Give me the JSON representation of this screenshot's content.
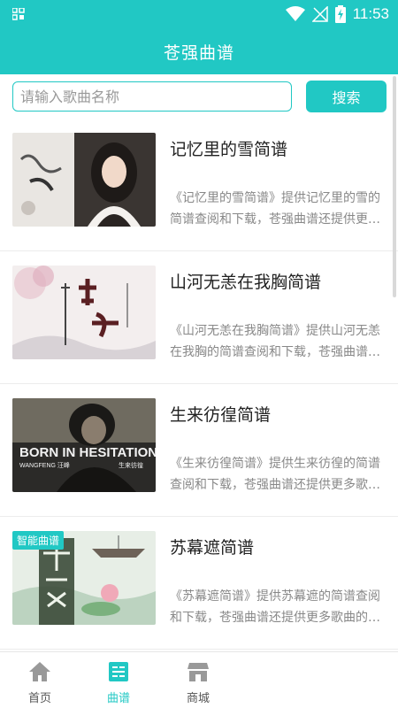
{
  "status_bar": {
    "time": "11:53"
  },
  "header": {
    "title": "苍强曲谱"
  },
  "search": {
    "placeholder": "请输入歌曲名称",
    "value": "",
    "button_label": "搜索"
  },
  "songs": [
    {
      "title": "记忆里的雪简谱",
      "description": "《记忆里的雪简谱》提供记忆里的雪的简谱查阅和下载，苍强曲谱还提供更多歌曲的简谱。",
      "thumbnail": "snow-memory-cover"
    },
    {
      "title": "山河无恙在我胸简谱",
      "description": "《山河无恙在我胸简谱》提供山河无恙在我胸的简谱查阅和下载，苍强曲谱还提供更多歌曲的简谱。",
      "thumbnail": "mountain-river-cover"
    },
    {
      "title": "生来彷徨简谱",
      "description": "《生来彷徨简谱》提供生来彷徨的简谱查阅和下载，苍强曲谱还提供更多歌曲的简谱。",
      "thumbnail": "born-in-hesitation-cover",
      "cover_text": [
        "BORN IN HESITATION",
        "WANGFENG 汪峰",
        "生来彷徨"
      ]
    },
    {
      "title": "苏幕遮简谱",
      "description": "《苏幕遮简谱》提供苏幕遮的简谱查阅和下载，苍强曲谱还提供更多歌曲的简谱。",
      "thumbnail": "su-mu-zhe-cover",
      "badge": "智能曲谱"
    }
  ],
  "bottom_nav": [
    {
      "label": "首页",
      "icon": "home-icon",
      "active": false
    },
    {
      "label": "曲谱",
      "icon": "score-icon",
      "active": true
    },
    {
      "label": "商城",
      "icon": "store-icon",
      "active": false
    }
  ],
  "colors": {
    "accent": "#21c8c4",
    "text": "#222222",
    "muted": "#888888"
  }
}
